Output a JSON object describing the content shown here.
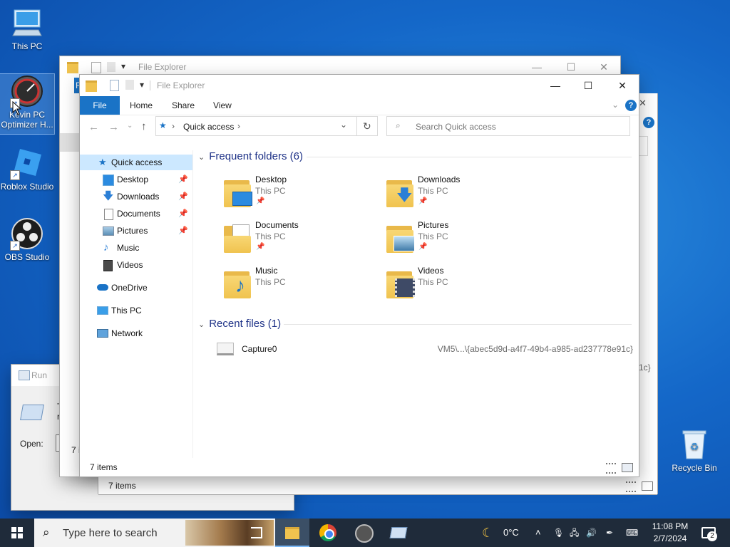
{
  "desktop": {
    "icons": [
      {
        "label": "This PC"
      },
      {
        "label": "Kevin PC Optimizer H..."
      },
      {
        "label": "Roblox Studio"
      },
      {
        "label": "OBS Studio"
      },
      {
        "label": "Recycle Bin"
      }
    ]
  },
  "back_window": {
    "title": "File Explorer",
    "tab_file": "F",
    "status": "7 items",
    "partial_text": "1c}",
    "row_text": "7 i"
  },
  "run_dialog": {
    "title": "Run",
    "body_partial": "Ty",
    "body_partial2": "re",
    "open_label": "Open:"
  },
  "explorer": {
    "title": "File Explorer",
    "ribbon": {
      "file": "File",
      "home": "Home",
      "share": "Share",
      "view": "View"
    },
    "address": "Quick access",
    "search_placeholder": "Search Quick access",
    "nav": {
      "quick_access": "Quick access",
      "desktop": "Desktop",
      "downloads": "Downloads",
      "documents": "Documents",
      "pictures": "Pictures",
      "music": "Music",
      "videos": "Videos",
      "onedrive": "OneDrive",
      "this_pc": "This PC",
      "network": "Network"
    },
    "frequent_header": "Frequent folders (6)",
    "folders": [
      {
        "name": "Desktop",
        "location": "This PC"
      },
      {
        "name": "Downloads",
        "location": "This PC"
      },
      {
        "name": "Documents",
        "location": "This PC"
      },
      {
        "name": "Pictures",
        "location": "This PC"
      },
      {
        "name": "Music",
        "location": "This PC"
      },
      {
        "name": "Videos",
        "location": "This PC"
      }
    ],
    "recent_header": "Recent files (1)",
    "recent": [
      {
        "name": "Capture0",
        "path": "VM5\\...\\{abec5d9d-a4f7-49b4-a985-ad237778e91c}"
      }
    ],
    "status": "7 items"
  },
  "taskbar": {
    "search_placeholder": "Type here to search",
    "temperature": "0°C",
    "time": "11:08 PM",
    "date": "2/7/2024",
    "notification_count": "2"
  },
  "colors": {
    "accent": "#1a73c6",
    "taskbar": "#1f2b3a",
    "folder": "#f0c34f"
  }
}
